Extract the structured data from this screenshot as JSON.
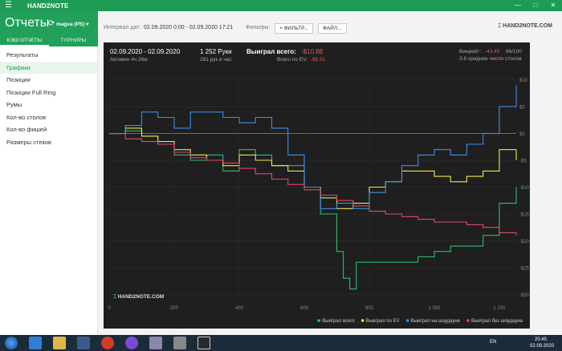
{
  "app": {
    "name": "HAND2NOTE"
  },
  "header": {
    "title": "Отчеты",
    "account": "magva (PS)"
  },
  "tabs": [
    {
      "label": "КЭШ ОТЧЕТЫ"
    },
    {
      "label": "ТУРНИРЫ"
    }
  ],
  "nav": [
    {
      "label": "Результаты"
    },
    {
      "label": "Графики"
    },
    {
      "label": "Позиции"
    },
    {
      "label": "Позиции Full Ring"
    },
    {
      "label": "Румы"
    },
    {
      "label": "Кол-во столов"
    },
    {
      "label": "Кол-во фишей"
    },
    {
      "label": "Размеры стеков"
    }
  ],
  "filterbar": {
    "interval_label": "Интервал дат:",
    "interval_value": "02.09.2020 0:00 - 02.09.2020 17:21",
    "filters_label": "Фильтры:",
    "filter_button": "ФИЛЬТР...",
    "file_button": "ФАЙЛ...",
    "brand": "HAND2NOTE.COM"
  },
  "stats": {
    "date_range": "02.09.2020 - 02.09.2020",
    "active": "Активен 4ч 26м",
    "hands": "1 252 Руки",
    "hands_per_hour": "281 рук в час",
    "won_label": "Выиграл всего:",
    "won_value": "-$10.88",
    "ev_label": "Всего по EV:",
    "ev_value": "-$5.51",
    "winrate_label": "Винрейт:",
    "winrate_value": "-43.45",
    "winrate_unit": "66/100",
    "avg_tables": "3.6 среднее число столов",
    "watermark": "HAND2NOTE.COM"
  },
  "colors": {
    "total": "#2dbd6e",
    "ev": "#f0e84a",
    "showdown": "#3d8fe8",
    "nonshowdown": "#e24a6a"
  },
  "chart_data": {
    "type": "line",
    "x_ticks": [
      "0",
      "200",
      "400",
      "600",
      "800",
      "1 000",
      "1 200"
    ],
    "y_ticks": [
      "$10",
      "$5",
      "$0",
      "-$5",
      "-$10",
      "-$15",
      "-$20",
      "-$25",
      "-$30"
    ],
    "xlim": [
      0,
      1252
    ],
    "ylim": [
      -31,
      11
    ],
    "grid": true,
    "legend_position": "bottom-right",
    "series": [
      {
        "name": "Выиграл всего",
        "color": "#2dbd6e",
        "x": [
          0,
          50,
          100,
          150,
          200,
          250,
          300,
          350,
          400,
          450,
          500,
          550,
          600,
          650,
          700,
          720,
          740,
          760,
          800,
          850,
          900,
          950,
          1000,
          1050,
          1100,
          1150,
          1200,
          1252
        ],
        "y": [
          0,
          0.5,
          -0.5,
          -2,
          -4,
          -5,
          -4,
          -7,
          -3,
          -4,
          -6,
          -6,
          -10,
          -15,
          -22,
          -27,
          -29,
          -24,
          -24,
          -24,
          -24,
          -23,
          -22,
          -21,
          -21,
          -19,
          -13,
          -10
        ]
      },
      {
        "name": "Выиграл по EV",
        "color": "#f0e84a",
        "x": [
          0,
          50,
          100,
          150,
          200,
          250,
          300,
          350,
          400,
          450,
          500,
          550,
          600,
          650,
          700,
          750,
          800,
          850,
          900,
          950,
          1000,
          1050,
          1100,
          1150,
          1200,
          1252
        ],
        "y": [
          0,
          1,
          -0.5,
          -1.5,
          -3,
          -4,
          -5,
          -6,
          -4,
          -5,
          -6,
          -7,
          -10,
          -12,
          -14,
          -13,
          -10,
          -9,
          -7,
          -7,
          -8,
          -9,
          -8,
          -7,
          -3,
          -5
        ]
      },
      {
        "name": "Выиграл на шоудауне",
        "color": "#3d8fe8",
        "x": [
          0,
          50,
          100,
          150,
          200,
          250,
          300,
          350,
          400,
          450,
          500,
          550,
          600,
          650,
          700,
          750,
          800,
          850,
          900,
          950,
          1000,
          1050,
          1100,
          1150,
          1200,
          1252
        ],
        "y": [
          0,
          1.5,
          4,
          3,
          1,
          4,
          4,
          3,
          2,
          3,
          1,
          -4,
          -10,
          -14,
          -13,
          -14,
          -11,
          -9,
          -6,
          -4,
          -3,
          -4,
          -2,
          0,
          5,
          9
        ]
      },
      {
        "name": "Выиграл без шоудауна",
        "color": "#e24a6a",
        "x": [
          0,
          50,
          100,
          150,
          200,
          250,
          300,
          350,
          400,
          450,
          500,
          550,
          600,
          650,
          700,
          750,
          800,
          850,
          900,
          950,
          1000,
          1050,
          1100,
          1150,
          1200,
          1252
        ],
        "y": [
          0,
          -1,
          -1.5,
          -2,
          -3.5,
          -4.5,
          -5,
          -5.5,
          -6.5,
          -7.5,
          -8.5,
          -9.5,
          -10.5,
          -11.5,
          -12.5,
          -13.5,
          -14.5,
          -15,
          -15.5,
          -16,
          -16.5,
          -16.5,
          -17,
          -17.5,
          -18.5,
          -19
        ]
      }
    ]
  },
  "taskbar": {
    "lang": "EN",
    "time": "20:45",
    "date": "02.09.2020"
  }
}
